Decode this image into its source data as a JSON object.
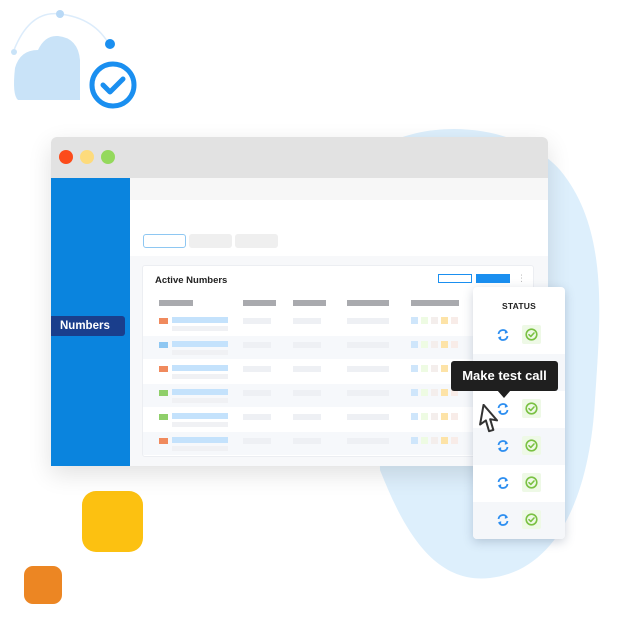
{
  "colors": {
    "accent": "#0a84de",
    "nav_active": "#1a3e8c",
    "primary_button": "#1a8ff0",
    "blob": "#ddeffc",
    "cloud": "#c9e3f8",
    "yellow_square": "#fcc111",
    "orange_square": "#ec8623",
    "success": "#7ac143",
    "sync": "#2d8ef0"
  },
  "window": {
    "traffic_lights": [
      "close",
      "minimize",
      "maximize"
    ]
  },
  "sidebar": {
    "items": [
      {
        "label": "Numbers",
        "active": true
      }
    ]
  },
  "card": {
    "title": "Active Numbers",
    "columns": 5,
    "rows": [
      {
        "flag_color": "#f08a5d",
        "status": "active"
      },
      {
        "flag_color": "#8ec7f2",
        "status": "active"
      },
      {
        "flag_color": "#f08a5d",
        "status": "active"
      },
      {
        "flag_color": "#8fcf6a",
        "status": "active"
      },
      {
        "flag_color": "#8fcf6a",
        "status": "active"
      },
      {
        "flag_color": "#f08a5d",
        "status": "active"
      }
    ]
  },
  "status_panel": {
    "header": "STATUS",
    "rows": 6,
    "sync_icon": "sync-icon",
    "status_icon": "check-circle-icon"
  },
  "tooltip": {
    "text": "Make test call"
  },
  "icons": {
    "cloud": "cloud-check-icon",
    "cursor": "mouse-pointer-icon"
  }
}
